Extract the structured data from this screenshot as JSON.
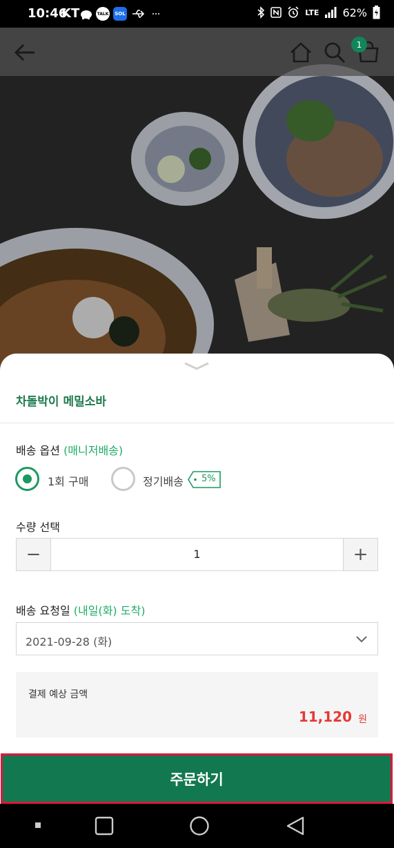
{
  "status_bar": {
    "time": "10:46",
    "carrier": "KT",
    "app_talk": "TALK",
    "app_sol": "SOL",
    "network": "LTE",
    "battery": "62%"
  },
  "header": {
    "cart_count": "1"
  },
  "product": {
    "title": "차돌박이 메밀소바"
  },
  "delivery_option": {
    "label": "배송 옵션",
    "label_accent": "(매니저배송)",
    "options": [
      {
        "label": "1회 구매",
        "selected": true
      },
      {
        "label": "정기배송",
        "selected": false,
        "discount": "5%"
      }
    ]
  },
  "quantity": {
    "label": "수량 선택",
    "minus": "−",
    "value": "1",
    "plus": "+"
  },
  "delivery_date": {
    "label": "배송 요청일",
    "label_accent": "(내일(화) 도착)",
    "selected_value": "2021-09-28 (화)"
  },
  "price": {
    "label": "결제 예상 금액",
    "amount": "11,120",
    "unit": "원"
  },
  "order_button": {
    "label": "주문하기"
  },
  "colors": {
    "brand_green": "#12784f",
    "accent_green": "#1eaa66",
    "price_red": "#e53935",
    "highlight_border": "#e0163a"
  }
}
